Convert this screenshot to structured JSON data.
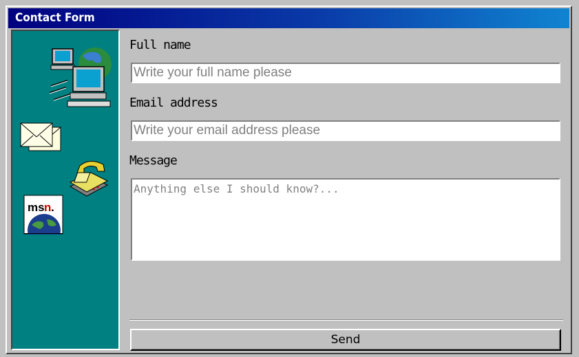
{
  "window": {
    "title": "Contact Form"
  },
  "sidebar": {
    "icons": [
      "network-computers-icon",
      "mail-envelope-icon",
      "telephone-icon",
      "msn-globe-icon"
    ],
    "msn_logo_text": "msn"
  },
  "form": {
    "name_label": "Full name",
    "name_placeholder": "Write your full name please",
    "email_label": "Email address",
    "email_placeholder": "Write your email address please",
    "message_label": "Message",
    "message_placeholder": "Anything else I should know?...",
    "send_label": "Send"
  },
  "colors": {
    "titlebar_start": "#000080",
    "titlebar_end": "#1084d0",
    "sidebar_bg": "#008080",
    "window_bg": "#c0c0c0"
  }
}
